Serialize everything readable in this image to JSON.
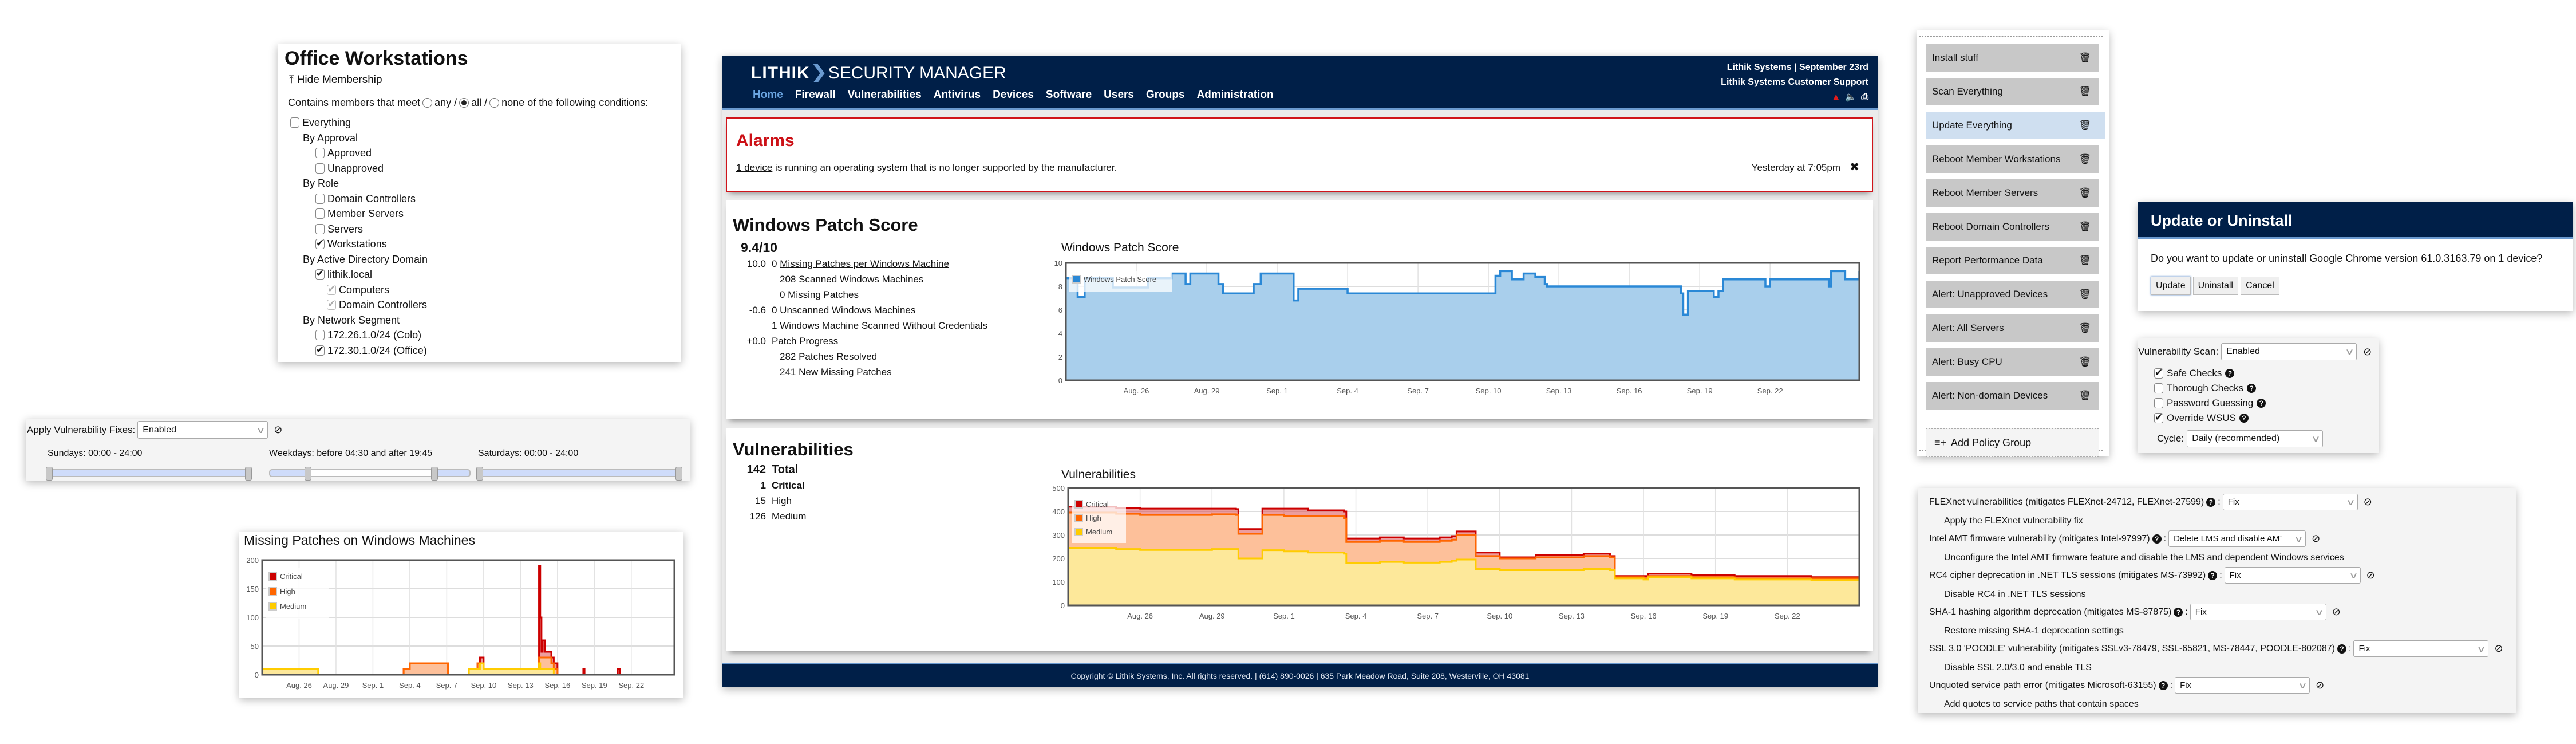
{
  "office_workstations": {
    "title": "Office Workstations",
    "hide_membership": "Hide Membership",
    "condition_prefix": "Contains members that meet",
    "condition_any": "any /",
    "condition_all": "all /",
    "condition_none": "none of the following conditions:",
    "condition_selected": "all",
    "tree": [
      {
        "label": "Everything",
        "level": 1,
        "type": "checkbox",
        "checked": false
      },
      {
        "label": "By Approval",
        "level": 2,
        "type": "heading"
      },
      {
        "label": "Approved",
        "level": 3,
        "type": "checkbox",
        "checked": false
      },
      {
        "label": "Unapproved",
        "level": 3,
        "type": "checkbox",
        "checked": false
      },
      {
        "label": "By Role",
        "level": 2,
        "type": "heading"
      },
      {
        "label": "Domain Controllers",
        "level": 3,
        "type": "checkbox",
        "checked": false
      },
      {
        "label": "Member Servers",
        "level": 3,
        "type": "checkbox",
        "checked": false
      },
      {
        "label": "Servers",
        "level": 3,
        "type": "checkbox",
        "checked": false
      },
      {
        "label": "Workstations",
        "level": 3,
        "type": "checkbox",
        "checked": true
      },
      {
        "label": "By Active Directory Domain",
        "level": 2,
        "type": "heading"
      },
      {
        "label": "lithik.local",
        "level": 3,
        "type": "checkbox",
        "checked": true
      },
      {
        "label": "Computers",
        "level": 4,
        "type": "checkbox",
        "checked": true,
        "dim": true
      },
      {
        "label": "Domain Controllers",
        "level": 4,
        "type": "checkbox",
        "checked": true,
        "dim": true
      },
      {
        "label": "By Network Segment",
        "level": 2,
        "type": "heading"
      },
      {
        "label": "172.26.1.0/24 (Colo)",
        "level": 3,
        "type": "checkbox",
        "checked": false
      },
      {
        "label": "172.30.1.0/24 (Office)",
        "level": 3,
        "type": "checkbox",
        "checked": true
      }
    ]
  },
  "apply_fixes": {
    "label": "Apply Vulnerability Fixes:",
    "value": "Enabled",
    "windows": [
      {
        "label": "Sundays: 00:00 - 24:00",
        "range_start": 0,
        "range_end": 1,
        "inverted": false
      },
      {
        "label": "Weekdays: before 04:30 and after 19:45",
        "range_start": 0.1875,
        "range_end": 0.8229,
        "inverted": true
      },
      {
        "label": "Saturdays: 00:00 - 24:00",
        "range_start": 0,
        "range_end": 1,
        "inverted": false
      }
    ]
  },
  "missing_patches_chart": {
    "title": "Missing Patches on Windows Machines"
  },
  "app": {
    "brand_bold": "LITHIK",
    "brand_rest": "SECURITY MANAGER",
    "nav": [
      "Home",
      "Firewall",
      "Vulnerabilities",
      "Antivirus",
      "Devices",
      "Software",
      "Users",
      "Groups",
      "Administration"
    ],
    "nav_active": "Home",
    "header_line1": "Lithik Systems | September 23rd",
    "header_line2": "Lithik Systems Customer Support",
    "header_icons": [
      "warning-icon",
      "volume-icon",
      "print-icon"
    ],
    "alarms": {
      "title": "Alarms",
      "link": "1 device",
      "message": " is running an operating system that is no longer supported by the manufacturer.",
      "time": "Yesterday at 7:05pm"
    },
    "patch_score": {
      "title": "Windows Patch Score",
      "score": "9.4/10",
      "rows": [
        {
          "num": "10.0",
          "text_prefix": "0 ",
          "link": "Missing Patches per Windows Machine",
          "indent": false
        },
        {
          "num": "",
          "text": "208 Scanned Windows Machines",
          "indent": true
        },
        {
          "num": "",
          "text": "0 Missing Patches",
          "indent": true
        },
        {
          "num": "-0.6",
          "text": "0 Unscanned Windows Machines",
          "indent": false
        },
        {
          "num": "",
          "text": "1 Windows Machine Scanned Without Credentials",
          "indent": false,
          "hang": true
        },
        {
          "num": "+0.0",
          "text": "Patch Progress",
          "indent": false
        },
        {
          "num": "",
          "text": "282 Patches Resolved",
          "indent": true
        },
        {
          "num": "",
          "text": "241 New Missing Patches",
          "indent": true
        }
      ],
      "chart_title": "Windows Patch Score"
    },
    "vulnerabilities": {
      "title": "Vulnerabilities",
      "rows": [
        {
          "num": "142",
          "label": "Total",
          "bold": true,
          "big": true
        },
        {
          "num": "1",
          "label": "Critical",
          "bold": true
        },
        {
          "num": "15",
          "label": "High",
          "bold": false
        },
        {
          "num": "126",
          "label": "Medium",
          "bold": false
        }
      ],
      "chart_title": "Vulnerabilities"
    },
    "footer": "Copyright © Lithik Systems, Inc. All rights reserved. | (614) 890-0026 | 635 Park Meadow Road, Suite 208, Westerville, OH 43081"
  },
  "policy_groups": {
    "items": [
      {
        "label": "Install stuff",
        "selected": false
      },
      {
        "label": "Scan Everything",
        "selected": false
      },
      {
        "label": "Update Everything",
        "selected": true
      },
      {
        "label": "Reboot Member Workstations",
        "selected": false
      },
      {
        "label": "Reboot Member Servers",
        "selected": false
      },
      {
        "label": "Reboot Domain Controllers",
        "selected": false
      },
      {
        "label": "Report Performance Data",
        "selected": false
      },
      {
        "label": "Alert: Unapproved Devices",
        "selected": false
      },
      {
        "label": "Alert: All Servers",
        "selected": false
      },
      {
        "label": "Alert: Busy CPU",
        "selected": false
      },
      {
        "label": "Alert: Non-domain Devices",
        "selected": false
      }
    ],
    "add_label": "Add Policy Group"
  },
  "update_modal": {
    "title": "Update or Uninstall",
    "question": "Do you want to update or uninstall Google Chrome version 61.0.3163.79 on 1 device?",
    "buttons": [
      "Update",
      "Uninstall",
      "Cancel"
    ]
  },
  "vuln_scan": {
    "label": "Vulnerability Scan:",
    "value": "Enabled",
    "options": [
      {
        "label": "Safe Checks",
        "checked": true
      },
      {
        "label": "Thorough Checks",
        "checked": false
      },
      {
        "label": "Password Guessing",
        "checked": false
      },
      {
        "label": "Override WSUS",
        "checked": true
      }
    ],
    "cycle_label": "Cycle:",
    "cycle_value": "Daily (recommended)"
  },
  "fixes": [
    {
      "label": "FLEXnet vulnerabilities (mitigates FLEXnet-24712, FLEXnet-27599)",
      "value": "Fix",
      "desc": "Apply the FLEXnet vulnerability fix"
    },
    {
      "label": "Intel AMT firmware vulnerability (mitigates Intel-97997)",
      "value": "Delete LMS and disable AMT",
      "desc": "Unconfigure the Intel AMT firmware feature and disable the LMS and dependent Windows services"
    },
    {
      "label": "RC4 cipher deprecation in .NET TLS sessions (mitigates MS-73992)",
      "value": "Fix",
      "desc": "Disable RC4 in .NET TLS sessions"
    },
    {
      "label": "SHA-1 hashing algorithm deprecation (mitigates MS-87875)",
      "value": "Fix",
      "desc": "Restore missing SHA-1 deprecation settings"
    },
    {
      "label": "SSL 3.0 'POODLE' vulnerability (mitigates SSLv3-78479, SSL-65821, MS-78447, POODLE-802087)",
      "value": "Fix",
      "desc": "Disable SSL 2.0/3.0 and enable TLS"
    },
    {
      "label": "Unquoted service path error (mitigates Microsoft-63155)",
      "value": "Fix",
      "desc": "Add quotes to service paths that contain spaces"
    }
  ],
  "colors": {
    "navy": "#001f48",
    "accent_blue": "#6a9ad0",
    "alarm_red": "#cc1016",
    "critical": "#cc0000",
    "high": "#ff6600",
    "medium": "#ffcc00",
    "patch_line": "#2a88d6",
    "patch_fill": "#a9cfec"
  },
  "chart_data": [
    {
      "id": "missing_patches",
      "type": "area",
      "title": "Missing Patches on Windows Machines",
      "xlabel": "",
      "ylabel": "",
      "x_ticks": [
        "Aug. 26",
        "Aug. 29",
        "Sep. 1",
        "Sep. 4",
        "Sep. 7",
        "Sep. 10",
        "Sep. 13",
        "Sep. 16",
        "Sep. 19",
        "Sep. 22"
      ],
      "x_range_days": [
        -3,
        30.5
      ],
      "ylim": [
        0,
        200
      ],
      "y_ticks": [
        0,
        50,
        100,
        150,
        200
      ],
      "grid": true,
      "legend": "top-left",
      "x": [
        -3,
        1.5,
        1.55,
        8,
        8.5,
        9,
        12,
        12.1,
        13,
        13.8,
        14.5,
        14.7,
        15,
        19.4,
        19.5,
        19.6,
        19.7,
        19.8,
        20,
        20.3,
        20.5,
        20.7,
        21,
        23,
        23.1,
        23.2,
        25.8,
        25.9,
        26.1,
        30.5
      ],
      "series": [
        {
          "name": "Critical",
          "color": "#cc0000",
          "values": [
            10,
            10,
            0,
            0,
            10,
            20,
            20,
            0,
            0,
            10,
            20,
            30,
            10,
            10,
            190,
            100,
            40,
            60,
            40,
            40,
            30,
            20,
            0,
            0,
            10,
            0,
            0,
            10,
            0,
            0
          ]
        },
        {
          "name": "High",
          "color": "#ff6600",
          "values": [
            10,
            10,
            0,
            0,
            10,
            20,
            20,
            0,
            0,
            10,
            20,
            20,
            10,
            10,
            30,
            30,
            30,
            30,
            30,
            30,
            20,
            10,
            0,
            0,
            0,
            0,
            0,
            0,
            0,
            0
          ]
        },
        {
          "name": "Medium",
          "color": "#ffcc00",
          "values": [
            10,
            10,
            0,
            0,
            0,
            0,
            0,
            0,
            0,
            10,
            10,
            20,
            10,
            10,
            20,
            10,
            10,
            10,
            10,
            10,
            10,
            0,
            0,
            0,
            0,
            0,
            0,
            0,
            0,
            0
          ]
        }
      ]
    },
    {
      "id": "patch_score",
      "type": "area",
      "title": "Windows Patch Score",
      "xlabel": "",
      "ylabel": "",
      "x_ticks": [
        "Aug. 26",
        "Aug. 29",
        "Sep. 1",
        "Sep. 4",
        "Sep. 7",
        "Sep. 10",
        "Sep. 13",
        "Sep. 16",
        "Sep. 19",
        "Sep. 22"
      ],
      "x_range_days": [
        -3,
        30.8
      ],
      "ylim": [
        0,
        10
      ],
      "y_ticks": [
        0,
        2,
        4,
        6,
        8,
        10
      ],
      "grid": true,
      "legend": "top-left",
      "x": [
        -3,
        -2.6,
        -2.5,
        -2.2,
        -1,
        0,
        0.5,
        1.5,
        2,
        2.1,
        2.3,
        2.4,
        3.5,
        3.7,
        4,
        5,
        5.3,
        5.5,
        5.8,
        6.7,
        6.9,
        8.7,
        9,
        12,
        12.2,
        12.5,
        12.7,
        15,
        15.3,
        15.5,
        15.8,
        16,
        16.5,
        17,
        17.3,
        17.4,
        17.5,
        18,
        18.3,
        18.5,
        23,
        23.2,
        23.3,
        23.5,
        23.8,
        24.5,
        24.6,
        24.8,
        25,
        26.5,
        26.8,
        27,
        29,
        29.2,
        29.5,
        29.6,
        29.8,
        30.2,
        30.8
      ],
      "series": [
        {
          "name": "Windows Patch Score",
          "color": "#2a88d6",
          "values": [
            8.7,
            8.7,
            7.1,
            8.7,
            7.9,
            7.9,
            8.7,
            9.1,
            9.1,
            8.2,
            9.1,
            9.1,
            8.2,
            7.4,
            7.4,
            8.2,
            9.1,
            9.1,
            9.1,
            6.8,
            7.8,
            7.8,
            7.4,
            7.4,
            7.4,
            7.4,
            7.4,
            7.4,
            8.9,
            9.3,
            9.3,
            8.6,
            9.1,
            8.8,
            8.8,
            8.2,
            8.0,
            8.0,
            8.0,
            8.0,
            8.0,
            7.4,
            5.6,
            7.6,
            7.6,
            7.6,
            7.1,
            7.6,
            8.6,
            8.6,
            8.0,
            8.6,
            8.6,
            8.6,
            8.0,
            9.3,
            9.3,
            8.6,
            9.3
          ]
        }
      ]
    },
    {
      "id": "vulnerabilities",
      "type": "area",
      "title": "Vulnerabilities",
      "xlabel": "",
      "ylabel": "",
      "x_ticks": [
        "Aug. 26",
        "Aug. 29",
        "Sep. 1",
        "Sep. 4",
        "Sep. 7",
        "Sep. 10",
        "Sep. 13",
        "Sep. 16",
        "Sep. 19",
        "Sep. 22"
      ],
      "x_range_days": [
        -3,
        30
      ],
      "ylim": [
        0,
        500
      ],
      "y_ticks": [
        0,
        100,
        200,
        300,
        400,
        500
      ],
      "grid": true,
      "legend": "top-left",
      "x": [
        -3,
        -1,
        0,
        3,
        4,
        4.1,
        5,
        5.1,
        6,
        7,
        8.5,
        8.6,
        10,
        11,
        12.5,
        13,
        13.2,
        14,
        15,
        16.5,
        18.5,
        19.6,
        19.8,
        21,
        21.2,
        23,
        24.7,
        24.8,
        28
      ],
      "series": [
        {
          "name": "Critical",
          "color": "#cc0000",
          "values": [
            420,
            415,
            412,
            412,
            410,
            325,
            325,
            412,
            412,
            405,
            400,
            285,
            290,
            285,
            290,
            295,
            315,
            225,
            205,
            215,
            220,
            210,
            125,
            125,
            135,
            130,
            130,
            125,
            120
          ]
        },
        {
          "name": "High",
          "color": "#ff6600",
          "values": [
            395,
            390,
            385,
            388,
            385,
            305,
            305,
            385,
            380,
            380,
            370,
            270,
            275,
            270,
            275,
            280,
            300,
            210,
            200,
            205,
            210,
            205,
            120,
            115,
            125,
            120,
            120,
            115,
            115
          ]
        },
        {
          "name": "Medium",
          "color": "#ffcc00",
          "values": [
            245,
            240,
            236,
            240,
            240,
            200,
            200,
            235,
            230,
            225,
            220,
            180,
            185,
            182,
            185,
            190,
            195,
            155,
            150,
            150,
            155,
            150,
            115,
            110,
            120,
            115,
            115,
            110,
            108
          ]
        }
      ]
    }
  ]
}
